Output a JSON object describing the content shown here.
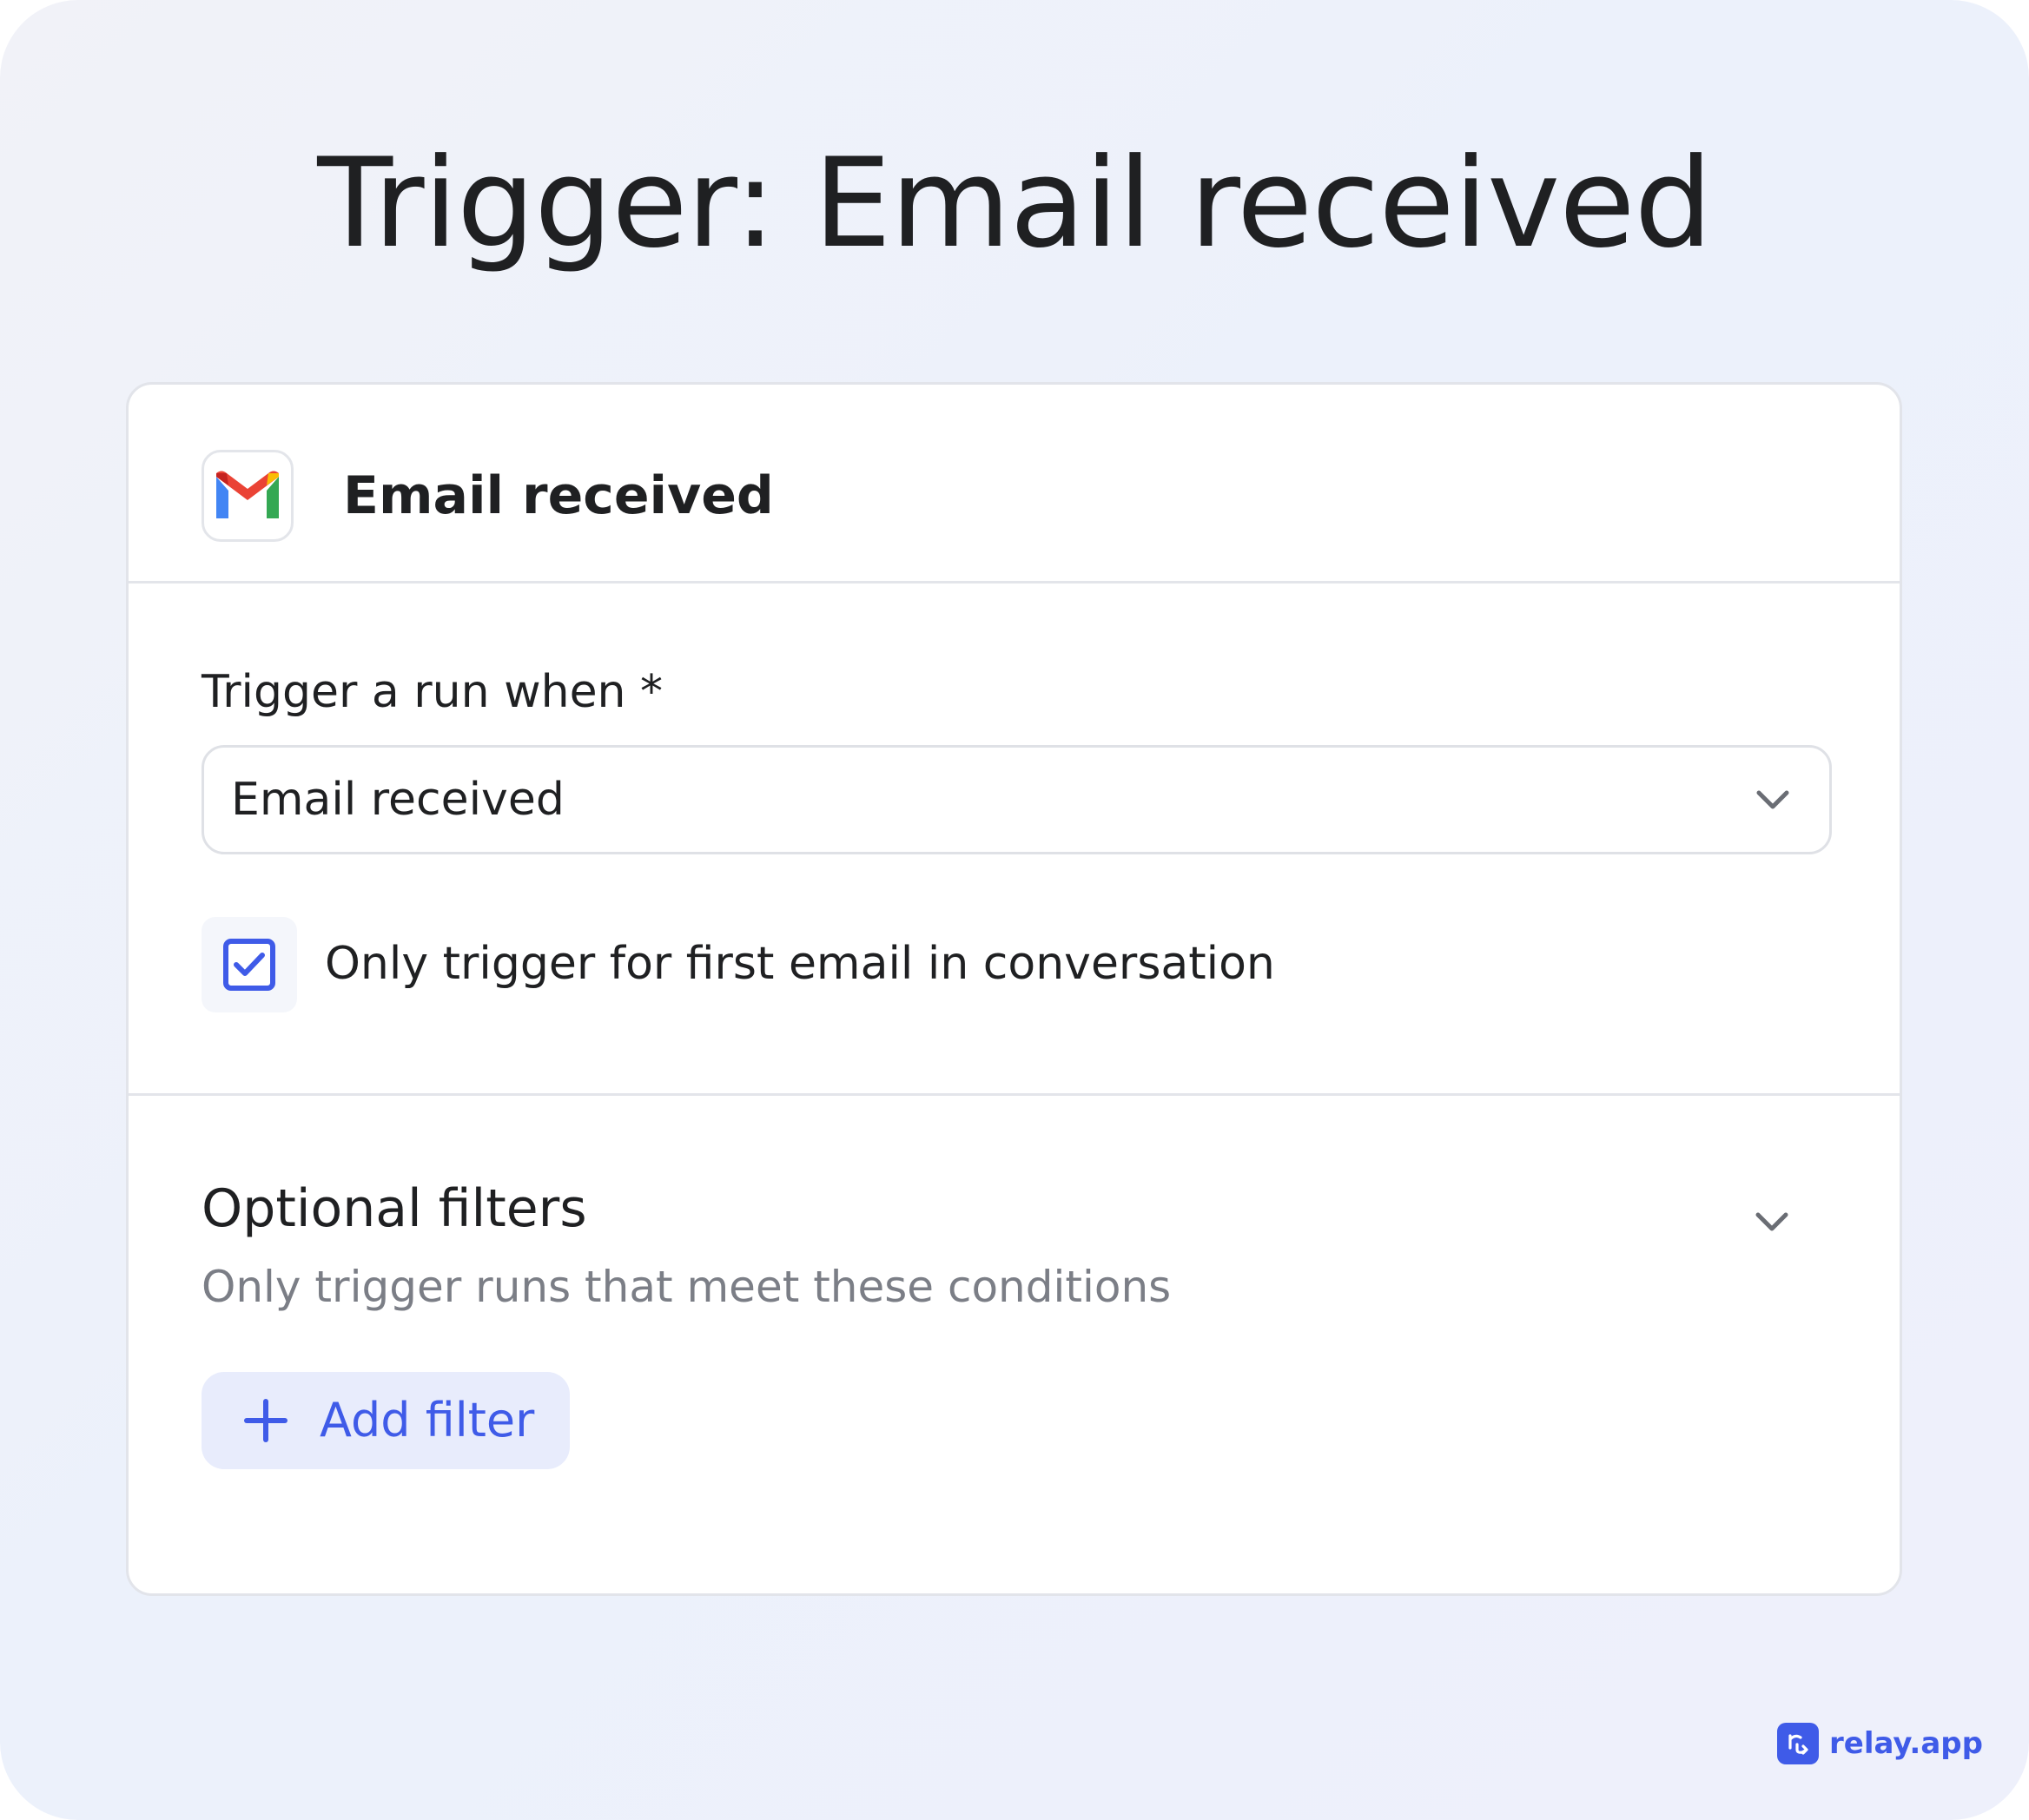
{
  "page_title": "Trigger: Email received",
  "card": {
    "app_icon": "gmail-icon",
    "title": "Email received"
  },
  "trigger": {
    "label": "Trigger a run when *",
    "selected_value": "Email received",
    "chevron_icon": "chevron-down-icon",
    "checkbox": {
      "checked": true,
      "label": "Only trigger for first email in conversation"
    }
  },
  "filters": {
    "title": "Optional filters",
    "subtitle": "Only trigger runs that meet these conditions",
    "chevron_icon": "chevron-down-icon",
    "add_button_label": "Add filter",
    "add_button_icon": "plus-icon"
  },
  "brand": {
    "name": "relay.app",
    "logo_icon": "relay-logo-icon"
  },
  "colors": {
    "accent": "#3f5be8",
    "accent_soft": "#e8ecfc",
    "text": "#1f2022",
    "muted_text": "#7b7e86",
    "border": "#e3e5ea"
  }
}
